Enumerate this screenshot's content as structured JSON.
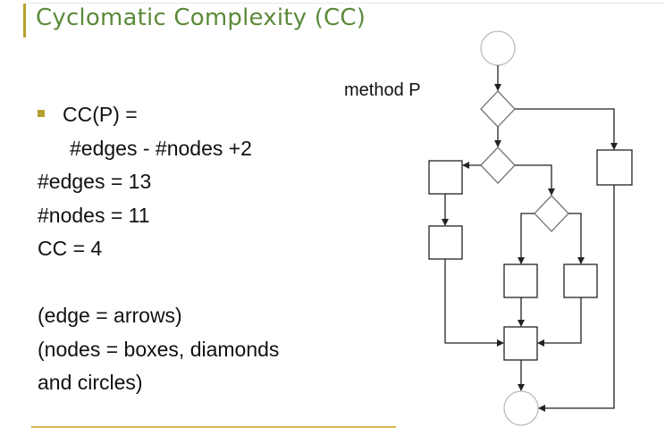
{
  "slide": {
    "title": "Cyclomatic Complexity (CC)",
    "bullet_line_1": "CC(P) =",
    "bullet_line_2": "#edges - #nodes +2",
    "edges_line": "#edges = 13",
    "nodes_line": "#nodes = 11",
    "cc_line": "CC = 4",
    "note_line_1": "(edge = arrows)",
    "note_line_2": "(nodes = boxes, diamonds",
    "note_line_3": "and circles)"
  },
  "diagram": {
    "label": "method P",
    "node_kinds": [
      "circle",
      "diamond",
      "box"
    ]
  },
  "colors": {
    "title": "#5c8a3a",
    "accent": "#b7a12e",
    "rule": "#d8b64a"
  }
}
